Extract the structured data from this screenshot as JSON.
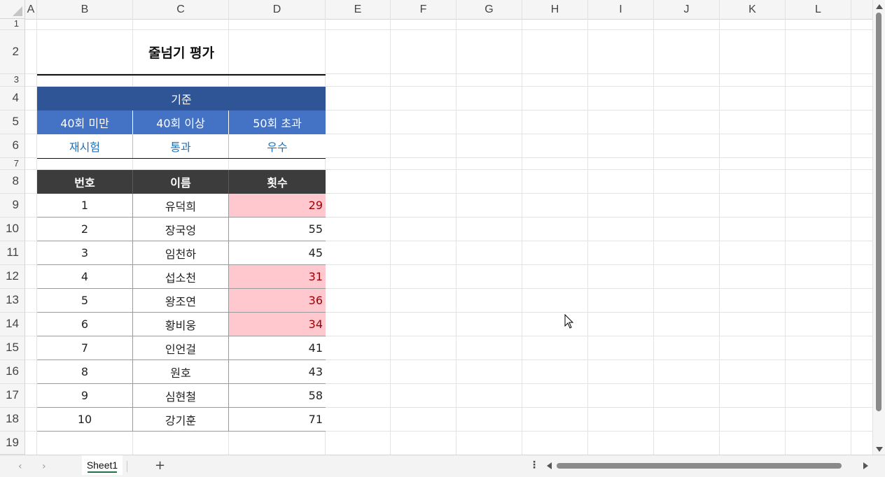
{
  "columns": [
    "A",
    "B",
    "C",
    "D",
    "E",
    "F",
    "G",
    "H",
    "I",
    "J",
    "K",
    "L"
  ],
  "rows": [
    "1",
    "2",
    "3",
    "4",
    "5",
    "6",
    "7",
    "8",
    "9",
    "10",
    "11",
    "12",
    "13",
    "14",
    "15",
    "16",
    "17",
    "18",
    "19"
  ],
  "title": "줄넘기 평가",
  "criteria": {
    "header": "기준",
    "levels": [
      "40회 미만",
      "40회 이상",
      "50회 초과"
    ],
    "results": [
      "재시험",
      "통과",
      "우수"
    ]
  },
  "table": {
    "headers": [
      "번호",
      "이름",
      "횟수"
    ],
    "rows": [
      {
        "no": "1",
        "name": "유덕희",
        "count": "29",
        "low": true
      },
      {
        "no": "2",
        "name": "장국엉",
        "count": "55",
        "low": false
      },
      {
        "no": "3",
        "name": "임천하",
        "count": "45",
        "low": false
      },
      {
        "no": "4",
        "name": "섭소천",
        "count": "31",
        "low": true
      },
      {
        "no": "5",
        "name": "왕조연",
        "count": "36",
        "low": true
      },
      {
        "no": "6",
        "name": "황비웅",
        "count": "34",
        "low": true
      },
      {
        "no": "7",
        "name": "인언걸",
        "count": "41",
        "low": false
      },
      {
        "no": "8",
        "name": "원호",
        "count": "43",
        "low": false
      },
      {
        "no": "9",
        "name": "심현철",
        "count": "58",
        "low": false
      },
      {
        "no": "10",
        "name": "강기훈",
        "count": "71",
        "low": false
      }
    ]
  },
  "sheet_tab": "Sheet1",
  "add_sheet": "+",
  "more_dots": "⋮",
  "nav_prev": "‹",
  "nav_next": "›",
  "colors": {
    "criteria_header": "#2f5597",
    "criteria_sub": "#4472c4",
    "result_text": "#1f70b8",
    "table_header": "#3c3c3c",
    "low_fill": "#ffc7ce",
    "low_text": "#9c0006",
    "sheet_tab_underline": "#217346"
  }
}
